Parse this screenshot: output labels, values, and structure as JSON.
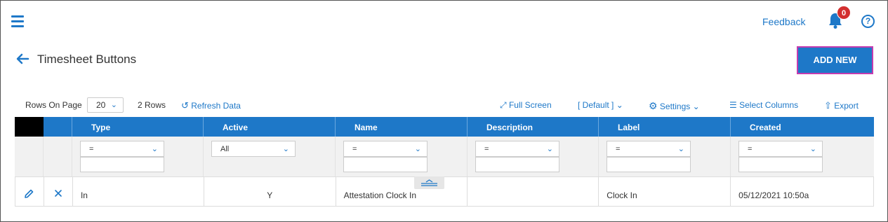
{
  "header": {
    "feedback_label": "Feedback",
    "notification_count": "0",
    "help_label": "?"
  },
  "page": {
    "title": "Timesheet Buttons",
    "add_new_label": "ADD NEW"
  },
  "toolbar": {
    "rows_on_page_label": "Rows On Page",
    "rows_on_page_value": "20",
    "row_count": "2 Rows",
    "refresh_label": "Refresh Data",
    "full_screen_label": "Full Screen",
    "view_label": "[ Default ]",
    "settings_label": "Settings",
    "select_columns_label": "Select Columns",
    "export_label": "Export"
  },
  "grid": {
    "columns": [
      "Type",
      "Active",
      "Name",
      "Description",
      "Label",
      "Created"
    ],
    "filters": {
      "type": "=",
      "active": "All",
      "name": "=",
      "description": "=",
      "label": "=",
      "created": "="
    },
    "rows": [
      {
        "type": "In",
        "active": "Y",
        "name": "Attestation Clock In",
        "description": "",
        "label": "Clock In",
        "created": "05/12/2021 10:50a"
      }
    ]
  },
  "colors": {
    "accent": "#1e78c8",
    "badge": "#d32f2f",
    "focus_border": "#c43bb0"
  }
}
